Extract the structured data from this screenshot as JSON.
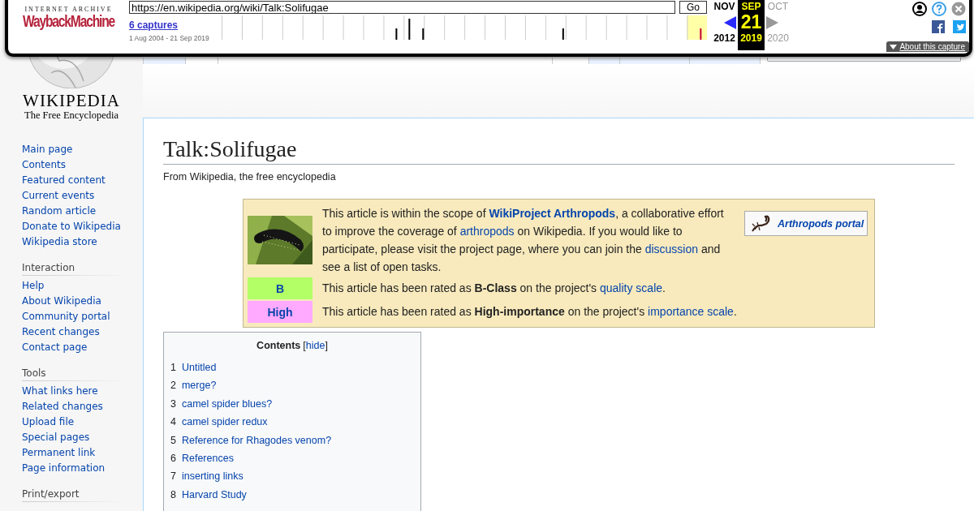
{
  "wayback": {
    "logo_top": "INTERNET ARCHIVE",
    "logo_name": "WaybackMachine",
    "url": "https://en.wikipedia.org/wiki/Talk:Solifugae",
    "go": "Go",
    "captures": "6 captures",
    "range": "1 Aug 2004 - 21 Sep 2019",
    "months": [
      {
        "month": "NOV",
        "year": "2012",
        "selected": false
      },
      {
        "month": "SEP",
        "day": "21",
        "year": "2019",
        "selected": true
      },
      {
        "month": "OCT",
        "year": "2020",
        "selected": false
      }
    ],
    "about": "About this capture"
  },
  "logo": {
    "wordmark": "WIKIPEDIA",
    "tagline": "The Free Encyclopedia"
  },
  "tabs_left": [
    {
      "selected": false
    },
    {
      "selected": true
    }
  ],
  "tabs_right": [
    {
      "selected": true
    },
    {
      "selected": false
    },
    {
      "selected": false
    },
    {
      "selected": false
    }
  ],
  "sidebar": [
    {
      "items": [
        "Main page",
        "Contents",
        "Featured content",
        "Current events",
        "Random article",
        "Donate to Wikipedia",
        "Wikipedia store"
      ]
    },
    {
      "heading": "Interaction",
      "items": [
        "Help",
        "About Wikipedia",
        "Community portal",
        "Recent changes",
        "Contact page"
      ]
    },
    {
      "heading": "Tools",
      "items": [
        "What links here",
        "Related changes",
        "Upload file",
        "Special pages",
        "Permanent link",
        "Page information"
      ]
    },
    {
      "heading": "Print/export"
    }
  ],
  "title": "Talk:Solifugae",
  "subtitle": "From Wikipedia, the free encyclopedia",
  "banner": {
    "notice": [
      {
        "t": "This article is within the scope of ",
        "kind": "plain"
      },
      {
        "t": "WikiProject Arthropods",
        "kind": "boldlink"
      },
      {
        "t": ", a collaborative effort to improve the coverage of ",
        "kind": "plain"
      },
      {
        "t": "arthropods",
        "kind": "link"
      },
      {
        "t": " on Wikipedia. If you would like to participate, please visit the project page, where you can join the ",
        "kind": "plain"
      },
      {
        "t": "discussion",
        "kind": "link"
      },
      {
        "t": " and see a list of open tasks.",
        "kind": "plain"
      }
    ],
    "portal": "Arthropods portal",
    "ratings": [
      {
        "grade": "B",
        "color": "#b2ff66",
        "text": [
          {
            "t": "This article has been rated as ",
            "kind": "plain"
          },
          {
            "t": "B-Class",
            "kind": "bold"
          },
          {
            "t": " on the project's ",
            "kind": "plain"
          },
          {
            "t": "quality scale",
            "kind": "link"
          },
          {
            "t": ".",
            "kind": "plain"
          }
        ]
      },
      {
        "grade": "High",
        "color": "#ffaaff",
        "text": [
          {
            "t": "This article has been rated as ",
            "kind": "plain"
          },
          {
            "t": "High-importance",
            "kind": "bold"
          },
          {
            "t": " on the project's ",
            "kind": "plain"
          },
          {
            "t": "importance scale",
            "kind": "link"
          },
          {
            "t": ".",
            "kind": "plain"
          }
        ]
      }
    ]
  },
  "toc": {
    "title": "Contents",
    "bracket_open": "[",
    "toggle": "hide",
    "bracket_close": "]",
    "items": [
      {
        "number": "1",
        "label": "Untitled"
      },
      {
        "number": "2",
        "label": "merge?"
      },
      {
        "number": "3",
        "label": "camel spider blues?"
      },
      {
        "number": "4",
        "label": "camel spider redux"
      },
      {
        "number": "5",
        "label": "Reference for Rhagodes venom?"
      },
      {
        "number": "6",
        "label": "References"
      },
      {
        "number": "7",
        "label": "inserting links"
      },
      {
        "number": "8",
        "label": "Harvard Study"
      }
    ]
  }
}
